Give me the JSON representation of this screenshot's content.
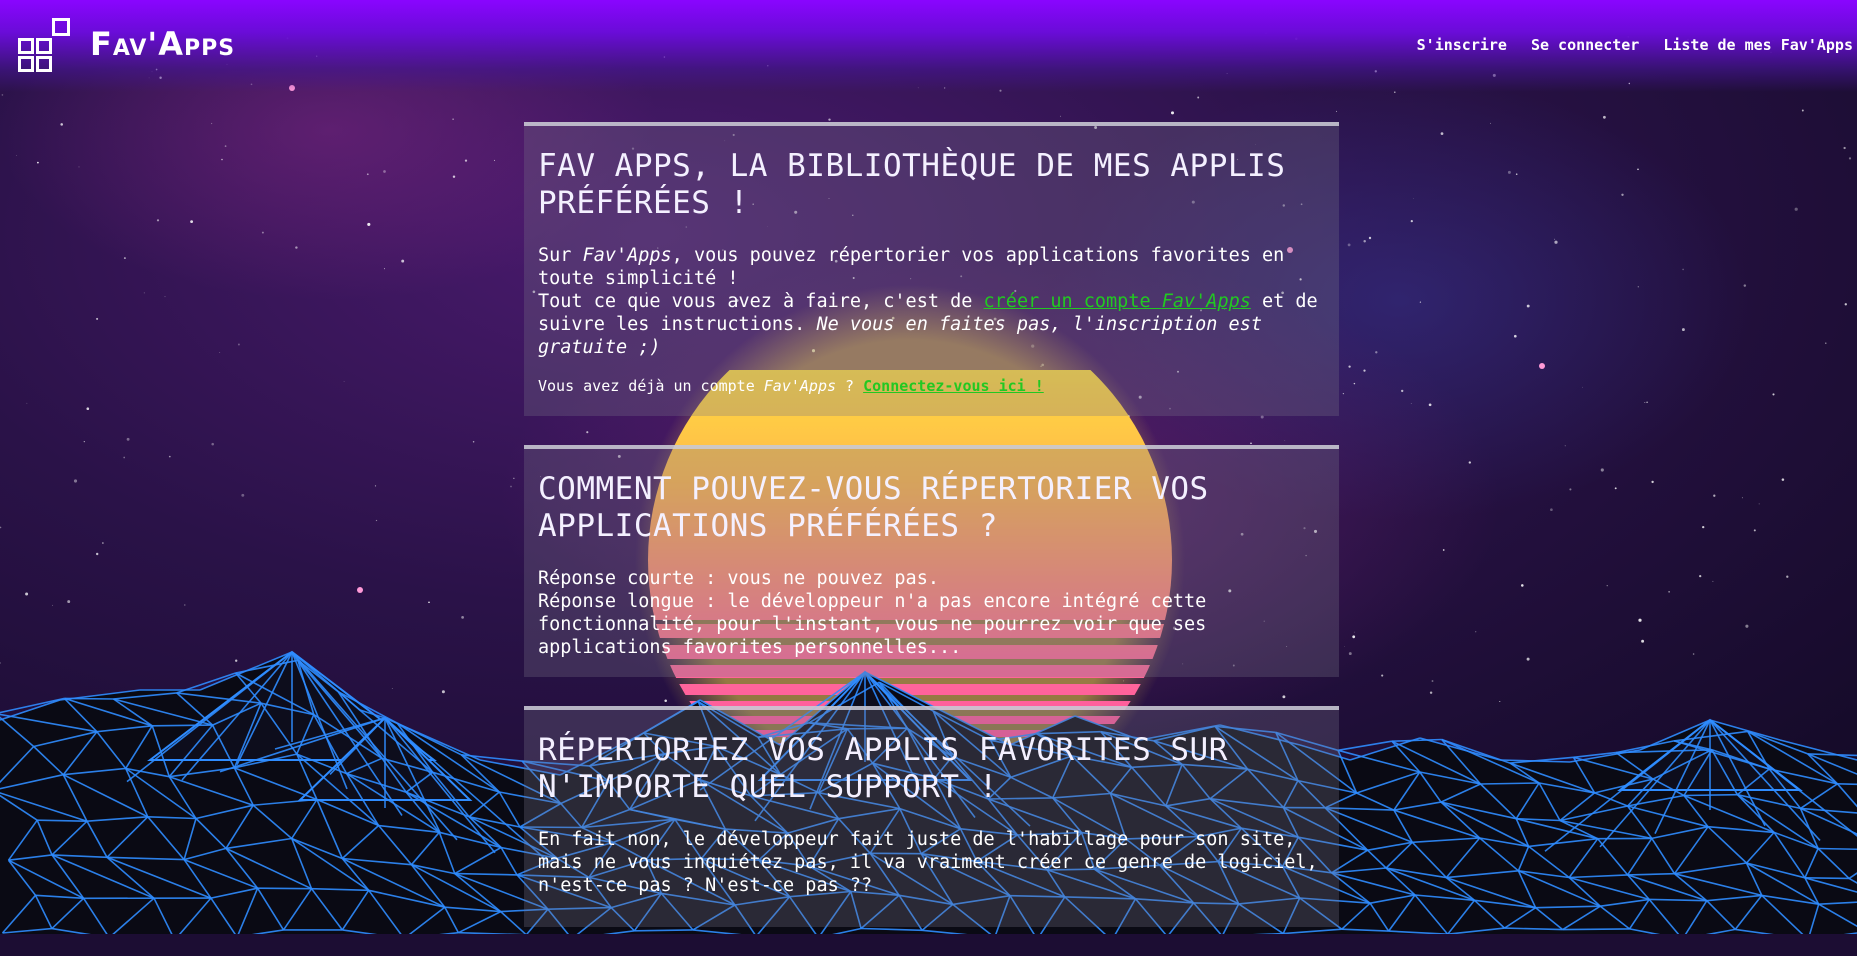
{
  "app": {
    "brand": "Fav'Apps"
  },
  "nav": {
    "items": [
      {
        "label": "S'inscrire",
        "name": "nav-sinscrire"
      },
      {
        "label": "Se connecter",
        "name": "nav-se-connecter"
      },
      {
        "label": "Liste de mes Fav'Apps",
        "name": "nav-liste-favapps"
      }
    ]
  },
  "cards": [
    {
      "title": "Fav Apps, la bibliothèque de mes applis préférées !",
      "p1_a": "Sur ",
      "p1_em": "Fav'Apps",
      "p1_b": ", vous pouvez répertorier vos applications favorites en toute simplicité !",
      "p2_a": "Tout ce que vous avez à faire, c'est de ",
      "p2_link_a": "créer un compte ",
      "p2_link_em": "Fav'Apps",
      "p2_b": " et de suivre les instructions. ",
      "p2_em": "Ne vous en faites pas, l'inscription est gratuite ;)",
      "small_a": "Vous avez déjà un compte ",
      "small_em": "Fav'Apps",
      "small_b": " ? ",
      "small_link": "Connectez-vous ici !"
    },
    {
      "title": "Comment pouvez-vous répertorier vos applications préférées ?",
      "line1": "Réponse courte : vous ne pouvez pas.",
      "line2": "Réponse longue : le développeur n'a pas encore intégré cette fonctionnalité, pour l'instant, vous ne pourrez voir que ses applications favorites personnelles..."
    },
    {
      "title": "Répertoriez vos applis favorites sur n'importe quel support !",
      "line1": "En fait non, le développeur fait juste de l'habillage pour son site, mais ne vous inquiétez pas, il va vraiment créer ce genre de logiciel, n'est-ce pas ? N'est-ce pas ??"
    }
  ],
  "colors": {
    "header_purple": "#8a05ff",
    "link_green": "#22c822",
    "grid_blue": "#2f8cff",
    "sun_yellow": "#ffe53a",
    "sun_pink": "#ff4fa0"
  }
}
